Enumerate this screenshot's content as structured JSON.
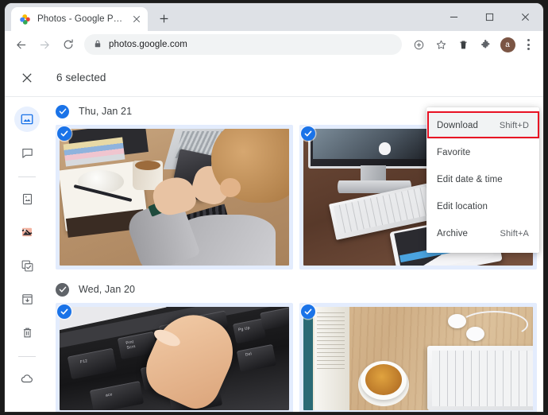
{
  "browser": {
    "tab": {
      "title": "Photos - Google Photos",
      "favicon": "google-photos-icon",
      "close": "×"
    },
    "new_tab_label": "+",
    "window_controls": {
      "minimize": "minimize-icon",
      "maximize": "maximize-icon",
      "close": "close-icon"
    },
    "nav": {
      "back": "back-arrow-icon",
      "forward": "forward-arrow-icon",
      "reload": "reload-icon"
    },
    "omnibox": {
      "lock": "lock-icon",
      "url": "photos.google.com"
    },
    "toolbar_icons": [
      "share-icon",
      "bookmark-star-icon",
      "delete-trash-icon",
      "extensions-puzzle-icon"
    ],
    "avatar_letter": "a",
    "menu_icon": "three-dot-menu-icon"
  },
  "app": {
    "close_selection_icon": "close-icon",
    "selection_text": "6 selected",
    "sidebar": [
      {
        "name": "photos",
        "icon": "photos-icon",
        "active": true
      },
      {
        "name": "chat",
        "icon": "chat-bubble-icon",
        "active": false
      },
      {
        "name": "divider",
        "icon": "divider",
        "active": false
      },
      {
        "name": "albums",
        "icon": "album-book-icon",
        "active": false
      },
      {
        "name": "explore",
        "icon": "explore-icon",
        "active": false
      },
      {
        "name": "sharing",
        "icon": "sharing-check-icon",
        "active": false
      },
      {
        "name": "archive",
        "icon": "archive-box-icon",
        "active": false
      },
      {
        "name": "trash",
        "icon": "trash-icon",
        "active": false
      },
      {
        "name": "divider2",
        "icon": "divider",
        "active": false
      },
      {
        "name": "storage",
        "icon": "cloud-icon",
        "active": false
      }
    ],
    "groups": [
      {
        "date_label": "Thu, Jan 21",
        "checked": true,
        "check_color": "#1a73e8",
        "photos": [
          {
            "alt": "person at desk using smartphone with coffee and notebook",
            "selected": true
          },
          {
            "alt": "imac desktop with keyboard and tablet on wooden desk",
            "selected": true
          }
        ]
      },
      {
        "date_label": "Wed, Jan 20",
        "checked": true,
        "check_color": "#5f6368",
        "photos": [
          {
            "alt": "finger pressing print screen key on black keyboard",
            "selected": true
          },
          {
            "alt": "flat lay of book coffee earbuds and keyboard on wood",
            "selected": true
          }
        ]
      }
    ]
  },
  "menu": {
    "items": [
      {
        "label": "Download",
        "shortcut": "Shift+D",
        "highlighted": true
      },
      {
        "label": "Favorite",
        "shortcut": "",
        "highlighted": false
      },
      {
        "label": "Edit date & time",
        "shortcut": "",
        "highlighted": false
      },
      {
        "label": "Edit location",
        "shortcut": "",
        "highlighted": false
      },
      {
        "label": "Archive",
        "shortcut": "Shift+A",
        "highlighted": false
      }
    ],
    "highlight_box_color": "#e81123"
  }
}
